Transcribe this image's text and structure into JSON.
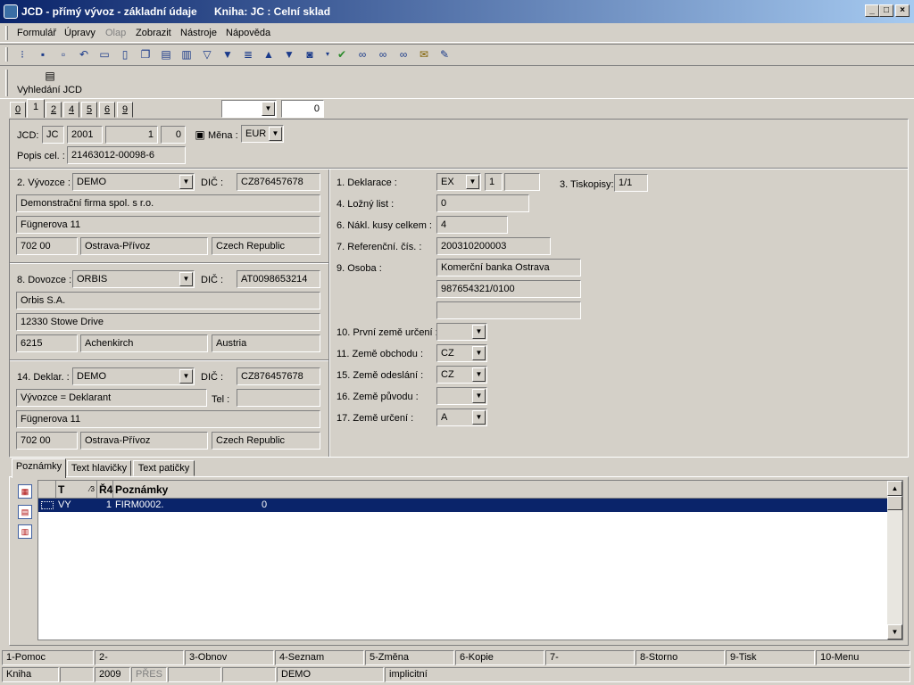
{
  "window": {
    "title": "JCD - přímý vývoz - základní údaje",
    "book": "Kniha: JC : Celní sklad"
  },
  "menu": [
    "Formulář",
    "Úpravy",
    "Olap",
    "Zobrazit",
    "Nástroje",
    "Nápověda"
  ],
  "toolbar2": {
    "search_label": "Vyhledání JCD"
  },
  "tabs": [
    "0",
    "1",
    "2",
    "4",
    "5",
    "6",
    "9"
  ],
  "tab_combo_value": "",
  "tab_number_value": "0",
  "header": {
    "jcd_label": "JCD:",
    "jcd_type": "JC",
    "jcd_year": "2001",
    "jcd_num1": "1",
    "jcd_num2": "0",
    "currency_label": "Měna :",
    "currency": "EUR",
    "popis_label": "Popis cel. :",
    "popis": "21463012-00098-6"
  },
  "exporter": {
    "label": "2. Vývozce :",
    "code": "DEMO",
    "dic_label": "DIČ :",
    "dic": "CZ876457678",
    "name": "Demonstrační firma spol. s r.o.",
    "street": "Fügnerova 11",
    "zip": "702 00",
    "city": "Ostrava-Přívoz",
    "country": "Czech Republic"
  },
  "importer": {
    "label": "8. Dovozce :",
    "code": "ORBIS",
    "dic_label": "DIČ :",
    "dic": "AT0098653214",
    "name": "Orbis S.A.",
    "street": "12330 Stowe Drive",
    "zip": "6215",
    "city": "Achenkirch",
    "country": "Austria"
  },
  "declarant": {
    "label": "14. Deklar. :",
    "code": "DEMO",
    "dic_label": "DIČ :",
    "dic": "CZ876457678",
    "name": "Vývozce = Deklarant",
    "tel_label": "Tel :",
    "tel": "",
    "street": "Fügnerova 11",
    "zip": "702 00",
    "city": "Ostrava-Přívoz",
    "country": "Czech Republic"
  },
  "right": {
    "deklarace_label": "1. Deklarace :",
    "deklarace": "EX",
    "deklarace_num": "1",
    "deklarace_extra": "",
    "tiskopisy_label": "3. Tiskopisy:",
    "tiskopisy": "1/1",
    "lozny_label": "4. Ložný list :",
    "lozny": "0",
    "kusy_label": "6. Nákl. kusy celkem :",
    "kusy": "4",
    "ref_label": "7. Referenční. čís. :",
    "ref": "200310200003",
    "osoba_label": "9. Osoba :",
    "osoba1": "Komerční banka Ostrava",
    "osoba2": "987654321/0100",
    "osoba3": "",
    "prvni_label": "10. První země určení :",
    "prvni": "",
    "obchod_label": "11. Země obchodu :",
    "obchod": "CZ",
    "odeslani_label": "15. Země  odeslání :",
    "odeslani": "CZ",
    "puvod_label": "16. Země původu :",
    "puvod": "",
    "urceni_label": "17. Země určení :",
    "urceni": "A"
  },
  "bottom_tabs": [
    "Poznámky",
    "Text hlavičky",
    "Text patičky"
  ],
  "grid": {
    "columns": [
      "T",
      "⁄3",
      "Ř4",
      "Poznámky"
    ],
    "rows": [
      {
        "t": "VY",
        "r": "1",
        "note": "FIRM0002.",
        "num": "0"
      }
    ]
  },
  "fkeys": [
    "1-Pomoc",
    "2-",
    "3-Obnov",
    "4-Seznam",
    "5-Změna",
    "6-Kopie",
    "7-",
    "8-Storno",
    "9-Tisk",
    "10-Menu"
  ],
  "status": {
    "mode": "Kniha",
    "blank1": "",
    "year": "2009",
    "pres": "PŘES",
    "blank2": "",
    "blank3": "",
    "user": "DEMO",
    "scheme": "implicitní"
  }
}
